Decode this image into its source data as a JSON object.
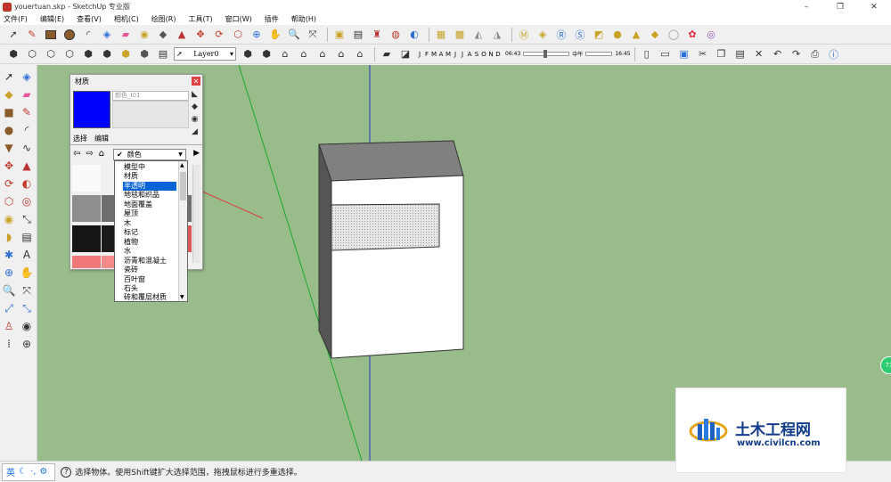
{
  "window": {
    "title": "youertuan.skp - SketchUp 专业版",
    "controls": [
      "–",
      "❐",
      "✕"
    ]
  },
  "menu": [
    "文件(F)",
    "编辑(E)",
    "查看(V)",
    "相机(C)",
    "绘图(R)",
    "工具(T)",
    "窗口(W)",
    "插件",
    "帮助(H)"
  ],
  "toolbar": {
    "layer_value": "Layer0",
    "shadow_months": [
      "J",
      "F",
      "M",
      "A",
      "M",
      "J",
      "J",
      "A",
      "S",
      "O",
      "N",
      "D"
    ],
    "time_start": "06:43",
    "time_mid": "中午",
    "time_end": "16:45"
  },
  "materials_panel": {
    "title": "材质",
    "name_field": "颜色_I01",
    "tab_select": "选择",
    "tab_edit": "编辑",
    "combo_value": "颜色",
    "swatch_color": "#0000ff"
  },
  "material_dropdown": {
    "options": [
      "模型中",
      "材质",
      "半透明",
      "地毯和织品",
      "地面覆盖",
      "屋顶",
      "木",
      "标记",
      "植物",
      "水",
      "沥青和混凝土",
      "瓷砖",
      "百叶窗",
      "石头",
      "砖和覆层材质"
    ],
    "selected": "半透明"
  },
  "status": {
    "ime_lang": "英",
    "text": "选择物体。使用Shift键扩大选择范围，拖拽鼠标进行多重选择。"
  },
  "side_badge": "73",
  "watermark": {
    "name": "土木工程网",
    "url": "www.civilcn.com"
  },
  "colors": {
    "viewport": "#98bd8b",
    "selection_blue": "#0a64d6",
    "watermark_blue": "#113c8c"
  }
}
